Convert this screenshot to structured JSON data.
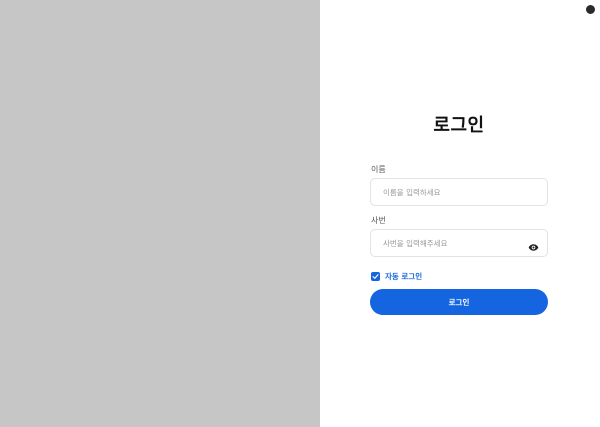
{
  "form": {
    "title": "로그인",
    "name_label": "이름",
    "name_placeholder": "이름을 입력하세요",
    "name_value": "",
    "id_label": "사번",
    "id_placeholder": "사번을 입력해주세요",
    "id_value": "",
    "remember_label": "자동 로그인",
    "remember_checked": true,
    "submit_label": "로그인"
  },
  "icons": {
    "password_toggle": "eye-icon",
    "checkbox": "check-icon",
    "corner": "status-dot"
  },
  "colors": {
    "accent": "#1565e0",
    "left_panel": "#c6c6c6",
    "background": "#ffffff"
  }
}
